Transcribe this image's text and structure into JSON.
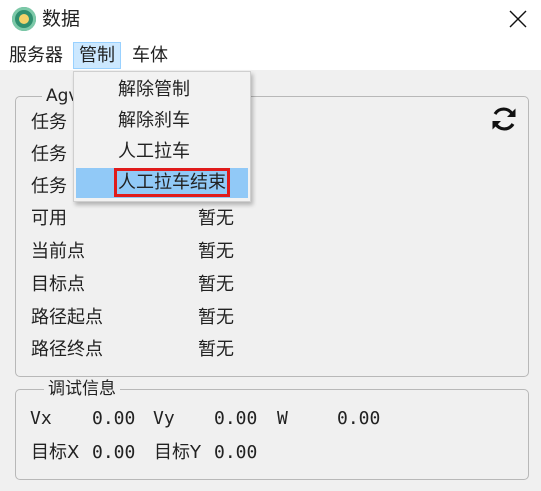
{
  "window": {
    "title": "数据"
  },
  "menubar": {
    "items": [
      "服务器",
      "管制",
      "车体"
    ],
    "active_index": 1
  },
  "dropdown": {
    "items": [
      "解除管制",
      "解除刹车",
      "人工拉车",
      "人工拉车结束"
    ],
    "highlighted_index": 3,
    "highlight_color": "#e01b1b"
  },
  "agv_group": {
    "title": "Agv",
    "rows": [
      {
        "label": "任务",
        "value": ""
      },
      {
        "label": "任务",
        "value": ""
      },
      {
        "label": "任务",
        "value": ""
      },
      {
        "label": "可用",
        "value": "暂无"
      },
      {
        "label": "当前点",
        "value": "暂无"
      },
      {
        "label": "目标点",
        "value": "暂无"
      },
      {
        "label": "路径起点",
        "value": "暂无"
      },
      {
        "label": "路径终点",
        "value": "暂无"
      }
    ]
  },
  "debug_group": {
    "title": "调试信息",
    "vx_label": "Vx",
    "vx_value": "0.00",
    "vy_label": "Vy",
    "vy_value": "0.00",
    "w_label": "W",
    "w_value": "0.00",
    "tx_label": "目标X",
    "tx_value": "0.00",
    "ty_label": "目标Y",
    "ty_value": "0.00"
  },
  "icons": {
    "app": "app-icon",
    "close": "close-icon",
    "refresh": "refresh-icon"
  },
  "colors": {
    "menu_active_bg": "#cce8ff",
    "dropdown_hover_bg": "#91c9f7"
  }
}
